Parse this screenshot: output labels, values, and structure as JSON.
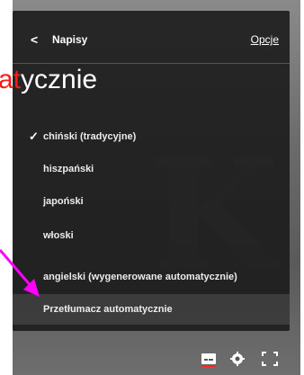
{
  "header": {
    "back_glyph": "<",
    "title": "Napisy",
    "options_label": "Opcje"
  },
  "overlay_text": {
    "red_part": "at",
    "tail_part": "ycznie"
  },
  "menu": {
    "items": [
      {
        "label": "chiński (tradycyjne)",
        "selected": true
      },
      {
        "label": "hiszpański",
        "selected": false
      },
      {
        "label": "japoński",
        "selected": false
      },
      {
        "label": "włoski",
        "selected": false
      },
      {
        "label": "angielski (wygenerowane automatycznie)",
        "selected": false
      },
      {
        "label": "Przetłumacz automatycznie",
        "selected": false,
        "highlighted": true
      }
    ],
    "check_glyph": "✓"
  },
  "colors": {
    "arrow": "#ff00ff",
    "overlay_red": "#ff1a1a",
    "menu_bg": "#1c1c1c"
  },
  "icons": {
    "subtitles": "subtitles-icon",
    "settings": "gear-icon",
    "fullscreen": "fullscreen-icon"
  }
}
